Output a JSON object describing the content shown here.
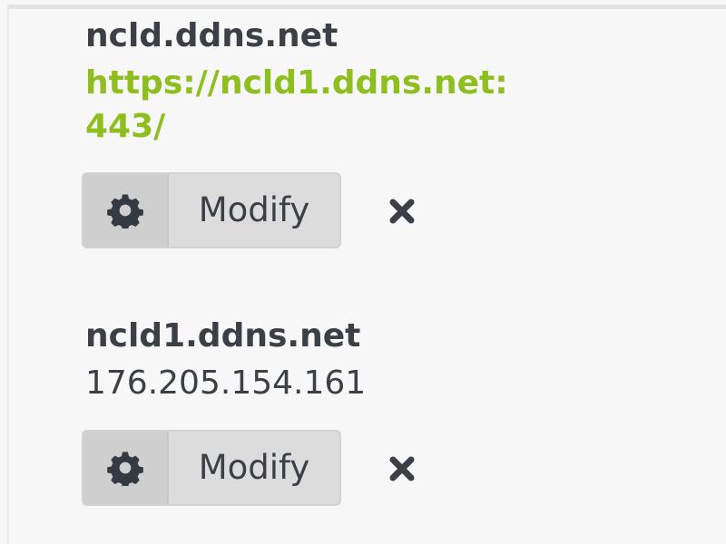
{
  "entries": [
    {
      "title": "ncld.ddns.net",
      "target": "https://ncld1.ddns.net:443/",
      "target_is_link": true,
      "modify_label": "Modify",
      "icons": {
        "modify": "gear-icon",
        "delete": "close-icon"
      }
    },
    {
      "title": "ncld1.ddns.net",
      "target": "176.205.154.161",
      "target_is_link": false,
      "modify_label": "Modify",
      "icons": {
        "modify": "gear-icon",
        "delete": "close-icon"
      }
    }
  ],
  "colors": {
    "link": "#8fbf1e",
    "text": "#3b4047",
    "button_bg": "#dcdcdc",
    "button_icon_bg": "#cfcfcf",
    "page_bg": "#f7f7f7"
  }
}
